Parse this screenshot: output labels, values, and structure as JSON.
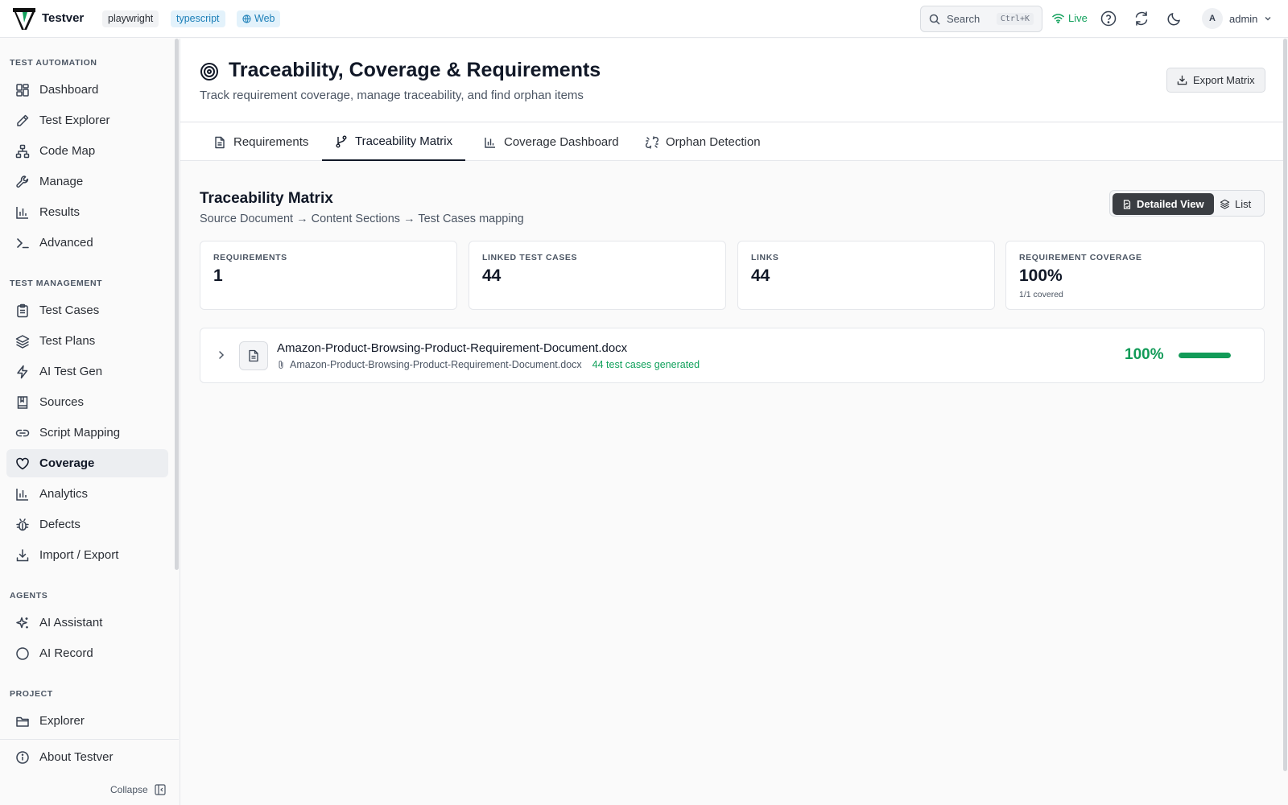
{
  "app": {
    "name": "Testver",
    "chips": [
      "playwright",
      "typescript",
      "Web"
    ],
    "search_label": "Search",
    "search_shortcut": "Ctrl+K",
    "live_label": "Live",
    "user_initial": "A",
    "user_name": "admin"
  },
  "sidebar": {
    "sections": {
      "automation": "TEST AUTOMATION",
      "management": "TEST MANAGEMENT",
      "agents": "AGENTS",
      "project": "PROJECT"
    },
    "items": [
      {
        "label": "Dashboard",
        "icon": "dashboard-icon"
      },
      {
        "label": "Test Explorer",
        "icon": "pencil-icon"
      },
      {
        "label": "Code Map",
        "icon": "network-icon"
      },
      {
        "label": "Manage",
        "icon": "wrench-icon"
      },
      {
        "label": "Results",
        "icon": "bar-chart-icon"
      },
      {
        "label": "Advanced",
        "icon": "terminal-icon"
      },
      {
        "label": "Test Cases",
        "icon": "clipboard-icon"
      },
      {
        "label": "Test Plans",
        "icon": "layers-icon"
      },
      {
        "label": "AI Test Gen",
        "icon": "lightning-icon"
      },
      {
        "label": "Sources",
        "icon": "book-icon"
      },
      {
        "label": "Script Mapping",
        "icon": "link-icon"
      },
      {
        "label": "Coverage",
        "icon": "heart-icon"
      },
      {
        "label": "Analytics",
        "icon": "bar-chart-icon"
      },
      {
        "label": "Defects",
        "icon": "bug-icon"
      },
      {
        "label": "Import / Export",
        "icon": "download-icon"
      },
      {
        "label": "AI Assistant",
        "icon": "sparkles-icon"
      },
      {
        "label": "AI Record",
        "icon": "circle-icon"
      },
      {
        "label": "Explorer",
        "icon": "folder-icon"
      }
    ],
    "active": "Coverage",
    "about_label": "About Testver",
    "collapse_label": "Collapse"
  },
  "page": {
    "title": "Traceability, Coverage & Requirements",
    "subtitle": "Track requirement coverage, manage traceability, and find orphan items",
    "export_label": "Export Matrix",
    "tabs": [
      {
        "label": "Requirements",
        "icon": "document-icon"
      },
      {
        "label": "Traceability Matrix",
        "icon": "branch-icon"
      },
      {
        "label": "Coverage Dashboard",
        "icon": "bar-chart-icon"
      },
      {
        "label": "Orphan Detection",
        "icon": "unlink-icon"
      }
    ],
    "active_tab": "Traceability Matrix"
  },
  "matrix": {
    "title": "Traceability Matrix",
    "subtitle": "Source Document → Content Sections → Test Cases mapping",
    "view_detailed": "Detailed View",
    "view_list": "List",
    "stats": [
      {
        "label": "REQUIREMENTS",
        "value": "1",
        "note": ""
      },
      {
        "label": "LINKED TEST CASES",
        "value": "44",
        "note": ""
      },
      {
        "label": "LINKS",
        "value": "44",
        "note": ""
      },
      {
        "label": "REQUIREMENT COVERAGE",
        "value": "100%",
        "note": "1/1 covered"
      }
    ],
    "requirement": {
      "name": "Amazon-Product-Browsing-Product-Requirement-Document.docx",
      "attachment": "Amazon-Product-Browsing-Product-Requirement-Document.docx",
      "generated": "44 test cases generated",
      "coverage_label": "100%",
      "coverage_fraction": 1.0
    }
  },
  "colors": {
    "accent_green": "#129b58",
    "link_blue": "#1c7fb8",
    "active_dark": "#3a3d42"
  }
}
